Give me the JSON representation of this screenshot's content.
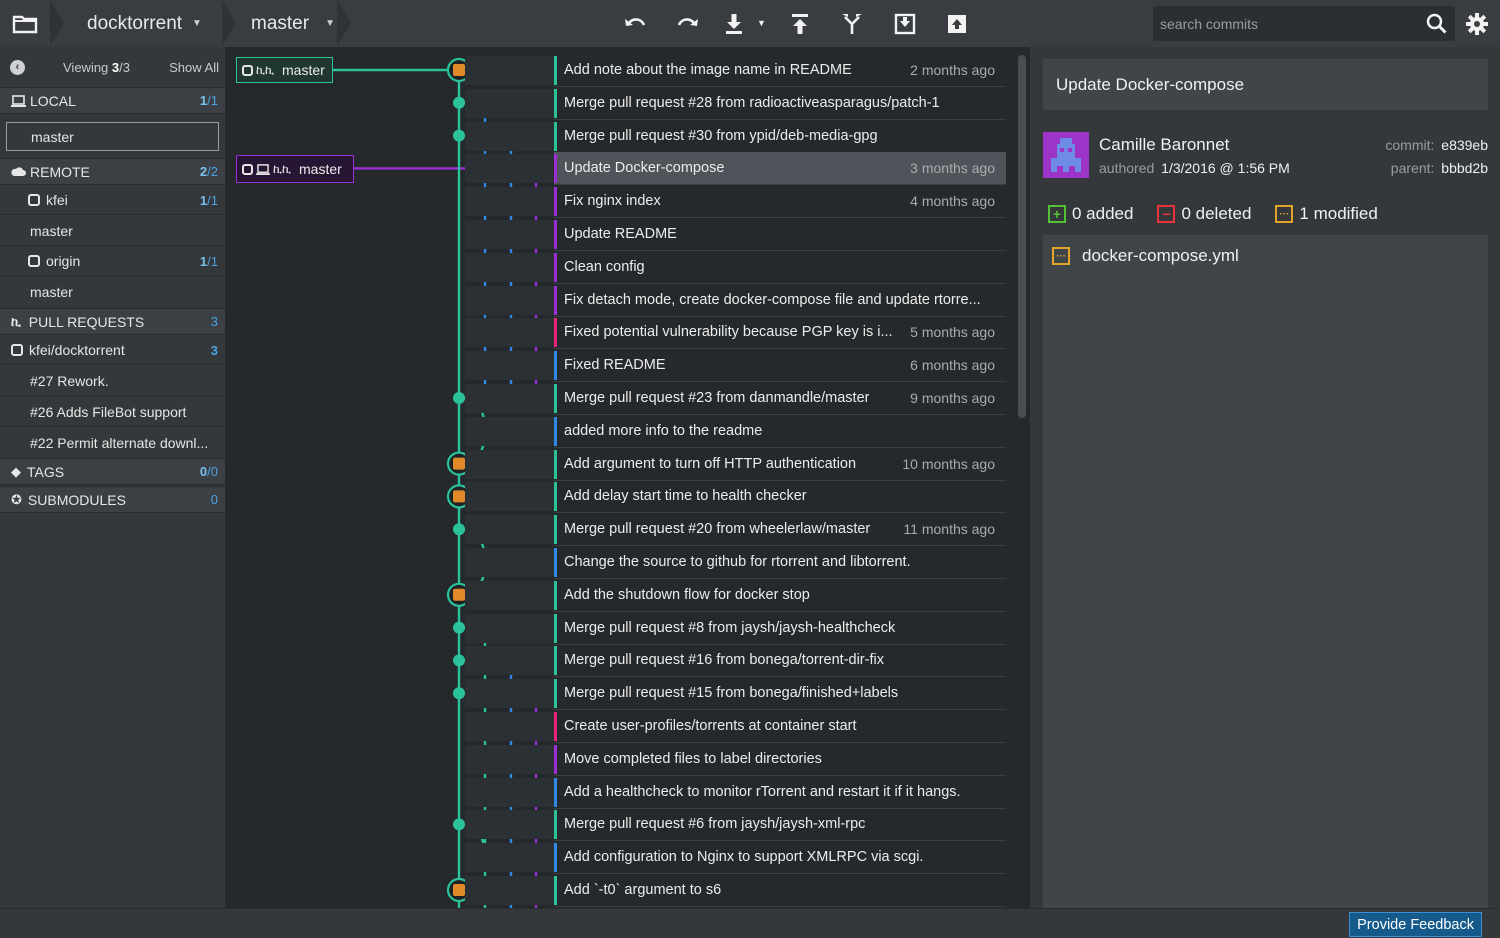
{
  "toolbar": {
    "repo": "docktorrent",
    "branch": "master",
    "search_placeholder": "search commits",
    "icons": [
      "folder-icon",
      "undo-icon",
      "redo-icon",
      "pull-icon",
      "push-icon",
      "branch-icon",
      "stash-icon",
      "pop-stash-icon",
      "search-icon",
      "gear-icon"
    ]
  },
  "sidebar": {
    "viewing_prefix": "Viewing",
    "viewing_count": "3",
    "viewing_total": "/3",
    "show_all": "Show All",
    "local": {
      "label": "LOCAL",
      "count": "1",
      "total": "/1",
      "branch": "master"
    },
    "remote": {
      "label": "REMOTE",
      "count": "2",
      "total": "/2",
      "remotes": [
        {
          "name": "kfei",
          "count": "1",
          "total": "/1",
          "branch": "master"
        },
        {
          "name": "origin",
          "count": "1",
          "total": "/1",
          "branch": "master"
        }
      ]
    },
    "pull_requests": {
      "label": "PULL REQUESTS",
      "count": "3",
      "repo": "kfei/docktorrent",
      "repo_count": "3",
      "items": [
        "#27 Rework.",
        "#26 Adds FileBot support",
        "#22 Permit alternate downl..."
      ]
    },
    "tags": {
      "label": "TAGS",
      "count": "0",
      "total": "/0"
    },
    "submodules": {
      "label": "SUBMODULES",
      "count": "0"
    }
  },
  "graph": {
    "tag1": "master",
    "tag2": "master",
    "colors": {
      "green": "#2bc29b",
      "blue": "#2e8ae6",
      "purple": "#9b2fd6",
      "pink": "#e8257a"
    },
    "commits": [
      {
        "msg": "Add note about the image name in README",
        "ago": "2 months ago",
        "lane": 0
      },
      {
        "msg": "Merge pull request #28 from radioactiveasparagus/patch-1",
        "ago": "",
        "lane": 0
      },
      {
        "msg": "Merge pull request #30 from ypid/deb-media-gpg",
        "ago": "",
        "lane": 0
      },
      {
        "msg": "Update Docker-compose",
        "ago": "3 months ago",
        "lane": 3
      },
      {
        "msg": "Fix nginx index",
        "ago": "4 months ago",
        "lane": 3
      },
      {
        "msg": "Update README",
        "ago": "",
        "lane": 3
      },
      {
        "msg": "Clean config",
        "ago": "",
        "lane": 3
      },
      {
        "msg": "Fix detach mode, create docker-compose file and update rtorre...",
        "ago": "",
        "lane": 3
      },
      {
        "msg": "Fixed potential vulnerability because PGP key is i...",
        "ago": "5 months ago",
        "lane": 2
      },
      {
        "msg": "Fixed README",
        "ago": "6 months ago",
        "lane": 1
      },
      {
        "msg": "Merge pull request #23 from danmandle/master",
        "ago": "9 months ago",
        "lane": 0
      },
      {
        "msg": "added more info to the readme",
        "ago": "",
        "lane": 1
      },
      {
        "msg": "Add argument to turn off HTTP authentication",
        "ago": "10 months ago",
        "lane": 0
      },
      {
        "msg": "Add delay start time to health checker",
        "ago": "",
        "lane": 0
      },
      {
        "msg": "Merge pull request #20 from wheelerlaw/master",
        "ago": "11 months ago",
        "lane": 0
      },
      {
        "msg": "Change the source to github for rtorrent and libtorrent.",
        "ago": "",
        "lane": 1
      },
      {
        "msg": "Add the shutdown flow for docker stop",
        "ago": "",
        "lane": 0
      },
      {
        "msg": "Merge pull request #8 from jaysh/jaysh-healthcheck",
        "ago": "",
        "lane": 0
      },
      {
        "msg": "Merge pull request #16 from bonega/torrent-dir-fix",
        "ago": "",
        "lane": 0
      },
      {
        "msg": "Merge pull request #15 from bonega/finished+labels",
        "ago": "",
        "lane": 0
      },
      {
        "msg": "Create user-profiles/torrents at container start",
        "ago": "",
        "lane": 2
      },
      {
        "msg": "Move completed files to label directories",
        "ago": "",
        "lane": 3
      },
      {
        "msg": "Add a healthcheck to monitor rTorrent and restart it if it hangs.",
        "ago": "",
        "lane": 1
      },
      {
        "msg": "Merge pull request #6 from jaysh/jaysh-xml-rpc",
        "ago": "",
        "lane": 0
      },
      {
        "msg": "Add configuration to Nginx to support XMLRPC via scgi.",
        "ago": "",
        "lane": 1
      },
      {
        "msg": "Add `-t0` argument to s6",
        "ago": "",
        "lane": 0
      }
    ]
  },
  "detail": {
    "title": "Update Docker-compose",
    "author": "Camille Baronnet",
    "authored_label": "authored",
    "authored_date": "1/3/2016 @ 1:56 PM",
    "commit_label": "commit:",
    "commit_sha": "e839eb",
    "parent_label": "parent:",
    "parent_sha": "bbbd2b",
    "added": "0 added",
    "deleted": "0 deleted",
    "modified": "1 modified",
    "files": [
      "docker-compose.yml"
    ]
  },
  "footer": {
    "feedback": "Provide Feedback"
  }
}
